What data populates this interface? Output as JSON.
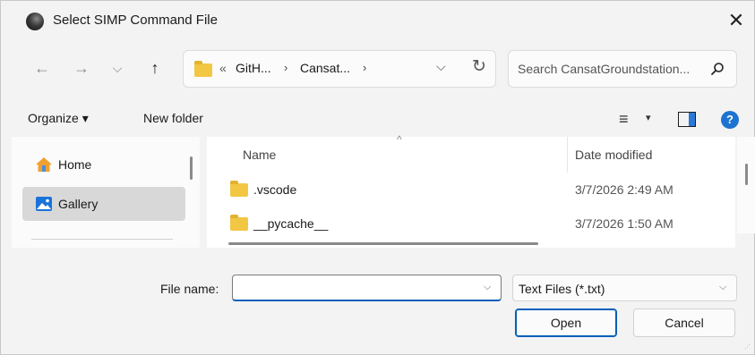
{
  "window": {
    "title": "Select SIMP Command File",
    "close_glyph": "✕"
  },
  "nav": {
    "back_glyph": "←",
    "forward_glyph": "→",
    "recent_glyph": "⌵",
    "up_glyph": "↑",
    "address": {
      "overflow": "«",
      "segments": [
        "GitH...",
        "Cansat..."
      ],
      "separator": "›",
      "dropdown_glyph": "⌵",
      "refresh_glyph": "↻"
    },
    "search_placeholder": "Search CansatGroundstation..."
  },
  "commandbar": {
    "organize_label": "Organize ▾",
    "new_folder_label": "New folder",
    "view_glyph": "≡",
    "view_caret": "▾",
    "help_glyph": "?"
  },
  "sidebar": {
    "items": [
      {
        "label": "Home",
        "icon": "home-icon",
        "selected": false
      },
      {
        "label": "Gallery",
        "icon": "gallery-icon",
        "selected": true
      }
    ]
  },
  "filelist": {
    "columns": {
      "name": "Name",
      "date": "Date modified"
    },
    "sort_glyph": "^",
    "rows": [
      {
        "name": ".vscode",
        "date": "3/7/2026 2:49 AM",
        "icon": "folder-icon"
      },
      {
        "name": "__pycache__",
        "date": "3/7/2026 1:50 AM",
        "icon": "folder-icon"
      }
    ]
  },
  "footer": {
    "filename_label": "File name:",
    "filename_value": "",
    "filename_caret": "⌵",
    "filetype_value": "Text Files (*.txt)",
    "filetype_caret": "⌵",
    "open_label": "Open",
    "cancel_label": "Cancel"
  },
  "colors": {
    "accent": "#005fb8",
    "folder": "#f2c744",
    "help": "#1d73d0"
  }
}
